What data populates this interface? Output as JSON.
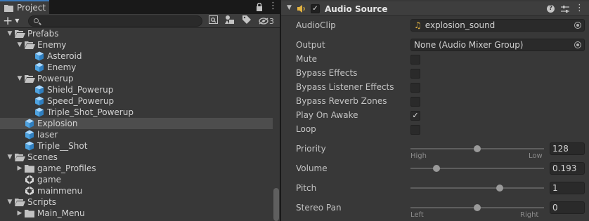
{
  "project": {
    "tab_label": "Project",
    "search": {
      "placeholder": "",
      "value": ""
    },
    "hidden_count": "3",
    "tree": [
      {
        "label": "Prefabs",
        "icon": "folder-open-icon",
        "expanded": true,
        "depth": 1
      },
      {
        "label": "Enemy",
        "icon": "folder-open-icon",
        "expanded": true,
        "depth": 2
      },
      {
        "label": "Asteroid",
        "icon": "prefab-icon",
        "depth": 3
      },
      {
        "label": "Enemy",
        "icon": "prefab-icon",
        "depth": 3
      },
      {
        "label": "Powerup",
        "icon": "folder-open-icon",
        "expanded": true,
        "depth": 2
      },
      {
        "label": "Shield_Powerup",
        "icon": "prefab-icon",
        "depth": 3
      },
      {
        "label": "Speed_Powerup",
        "icon": "prefab-icon",
        "depth": 3
      },
      {
        "label": "Triple_Shot_Powerup",
        "icon": "prefab-icon",
        "depth": 3
      },
      {
        "label": "Explosion",
        "icon": "prefab-icon",
        "depth": 2,
        "selected": true
      },
      {
        "label": "laser",
        "icon": "prefab-icon",
        "depth": 2
      },
      {
        "label": "Triple__Shot",
        "icon": "prefab-icon",
        "depth": 2
      },
      {
        "label": "Scenes",
        "icon": "folder-open-icon",
        "expanded": true,
        "depth": 1
      },
      {
        "label": "game_Profiles",
        "icon": "folder-icon",
        "expanded": false,
        "depth": 2
      },
      {
        "label": "game",
        "icon": "unity-scene-icon",
        "depth": 2
      },
      {
        "label": "mainmenu",
        "icon": "unity-scene-icon",
        "depth": 2
      },
      {
        "label": "Scripts",
        "icon": "folder-open-icon",
        "expanded": true,
        "depth": 1
      },
      {
        "label": "Main_Menu",
        "icon": "folder-icon",
        "expanded": false,
        "depth": 2
      }
    ]
  },
  "inspector": {
    "component_title": "Audio Source",
    "enabled": true,
    "audio_clip": {
      "label": "AudioClip",
      "value": "explosion_sound"
    },
    "output": {
      "label": "Output",
      "value": "None (Audio Mixer Group)"
    },
    "toggles": [
      {
        "label": "Mute",
        "checked": false
      },
      {
        "label": "Bypass Effects",
        "checked": false
      },
      {
        "label": "Bypass Listener Effects",
        "checked": false
      },
      {
        "label": "Bypass Reverb Zones",
        "checked": false
      },
      {
        "label": "Play On Awake",
        "checked": true
      },
      {
        "label": "Loop",
        "checked": false
      }
    ],
    "sliders": [
      {
        "label": "Priority",
        "value": "128",
        "fraction": 0.5,
        "min_label": "High",
        "max_label": "Low"
      },
      {
        "label": "Volume",
        "value": "0.193",
        "fraction": 0.193
      },
      {
        "label": "Pitch",
        "value": "1",
        "fraction": 0.667
      },
      {
        "label": "Stereo Pan",
        "value": "0",
        "fraction": 0.5,
        "min_label": "Left",
        "max_label": "Right"
      }
    ]
  },
  "colors": {
    "selection": "#4d4d4d",
    "prefab": "#6ab3e8",
    "folder": "#c2c2c2",
    "clip": "#e3b341",
    "tab_accent": "#3a79bb"
  }
}
